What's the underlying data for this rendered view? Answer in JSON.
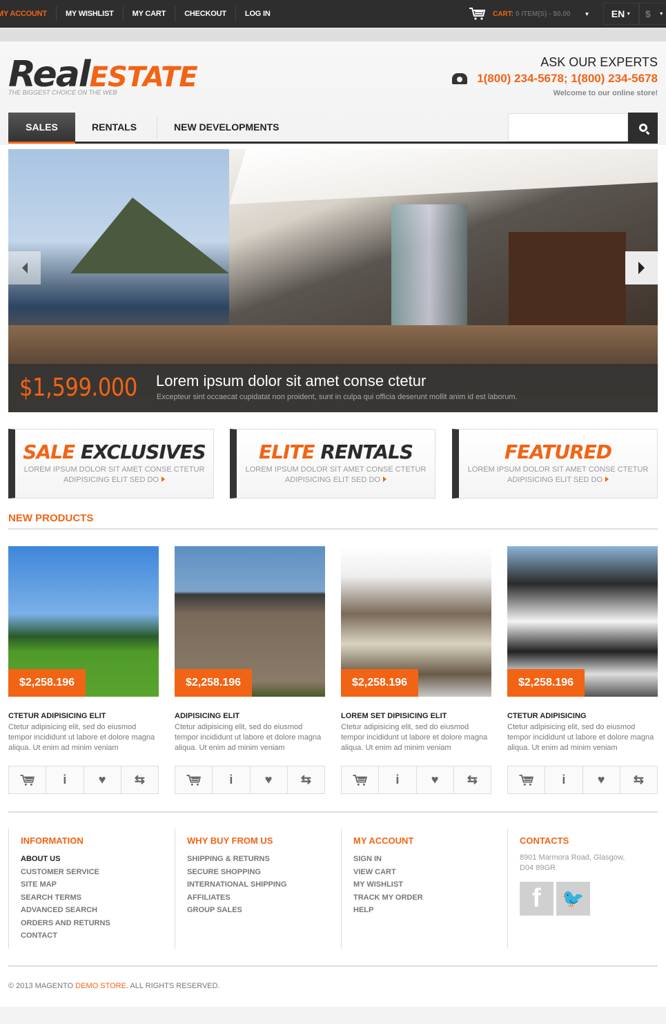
{
  "topbar": {
    "links": [
      "MY ACCOUNT",
      "MY WISHLIST",
      "MY CART",
      "CHECKOUT",
      "LOG IN"
    ],
    "cart_label": "CART:",
    "cart_value": "0 ITEM(S) - $0.00",
    "language": "EN",
    "currency": "$"
  },
  "header": {
    "logo_dark": "Real",
    "logo_orange": "ESTATE",
    "tagline": "THE BIGGEST CHOICE ON THE WEB",
    "ask": "ASK OUR EXPERTS",
    "phone": "1(800) 234-5678; 1(800) 234-5678",
    "welcome": "Welcome to our online store!"
  },
  "nav": {
    "items": [
      "SALES",
      "RENTALS",
      "NEW DEVELOPMENTS"
    ],
    "search_placeholder": ""
  },
  "slider": {
    "price": "$1,599.000",
    "title": "Lorem ipsum dolor sit amet conse ctetur",
    "subtitle": "Excepteur sint occaecat cupidatat non proident, sunt in culpa qui officia deserunt mollit anim id est laborum."
  },
  "banners": [
    {
      "orange": "SALE",
      "dark": "EXCLUSIVES",
      "line1": "LOREM IPSUM DOLOR SIT AMET CONSE CTETUR",
      "line2": "ADIPISICING ELIT SED DO"
    },
    {
      "orange": "ELITE",
      "dark": "RENTALS",
      "line1": "LOREM IPSUM DOLOR SIT AMET CONSE CTETUR",
      "line2": "ADIPISICING ELIT SED DO"
    },
    {
      "orange": "FEATURED",
      "dark": "",
      "line1": "LOREM IPSUM DOLOR SIT AMET CONSE CTETUR",
      "line2": "ADIPISICING ELIT SED DO"
    }
  ],
  "new_products": {
    "title": "NEW PRODUCTS",
    "items": [
      {
        "price": "$2,258.196",
        "name": "CTETUR ADIPISICING ELIT",
        "desc": "Ctetur adipisicing elit, sed do eiusmod tempor incididunt ut labore et dolore magna aliqua. Ut enim ad minim veniam"
      },
      {
        "price": "$2,258.196",
        "name": "ADIPISICING ELIT",
        "desc": "Ctetur adipisicing elit, sed do eiusmod tempor incididunt ut labore et dolore magna aliqua. Ut enim ad minim veniam"
      },
      {
        "price": "$2,258.196",
        "name": "LOREM SET DIPISICING ELIT",
        "desc": "Ctetur adipisicing elit, sed do eiusmod tempor incididunt ut labore et dolore magna aliqua. Ut enim ad minim veniam"
      },
      {
        "price": "$2,258.196",
        "name": "CTETUR ADIPISICING",
        "desc": "Ctetur adipisicing elit, sed do eiusmod tempor incididunt ut labore et dolore magna aliqua. Ut enim ad minim veniam"
      }
    ],
    "action_icons": [
      "cart-icon",
      "info-icon",
      "heart-icon",
      "compare-icon"
    ]
  },
  "footer": {
    "information": {
      "title": "INFORMATION",
      "links": [
        "ABOUT US",
        "CUSTOMER SERVICE",
        "SITE MAP",
        "SEARCH TERMS",
        "ADVANCED SEARCH",
        "ORDERS AND RETURNS",
        "CONTACT"
      ]
    },
    "why_buy": {
      "title": "WHY BUY FROM US",
      "links": [
        "SHIPPING & RETURNS",
        "SECURE SHOPPING",
        "INTERNATIONAL SHIPPING",
        "AFFILIATES",
        "GROUP SALES"
      ]
    },
    "my_account": {
      "title": "MY ACCOUNT",
      "links": [
        "SIGN IN",
        "VIEW CART",
        "MY WISHLIST",
        "TRACK MY ORDER",
        "HELP"
      ]
    },
    "contacts": {
      "title": "CONTACTS",
      "address_line1": "8901 Marmora Road, Glasgow,",
      "address_line2": "D04 89GR"
    },
    "copyright_pre": "© 2013 MAGENTO ",
    "copyright_link": "DEMO STORE",
    "copyright_post": ".  ALL RIGHTS RESERVED."
  },
  "colors": {
    "accent": "#f26415",
    "dark": "#2e2e2e"
  }
}
